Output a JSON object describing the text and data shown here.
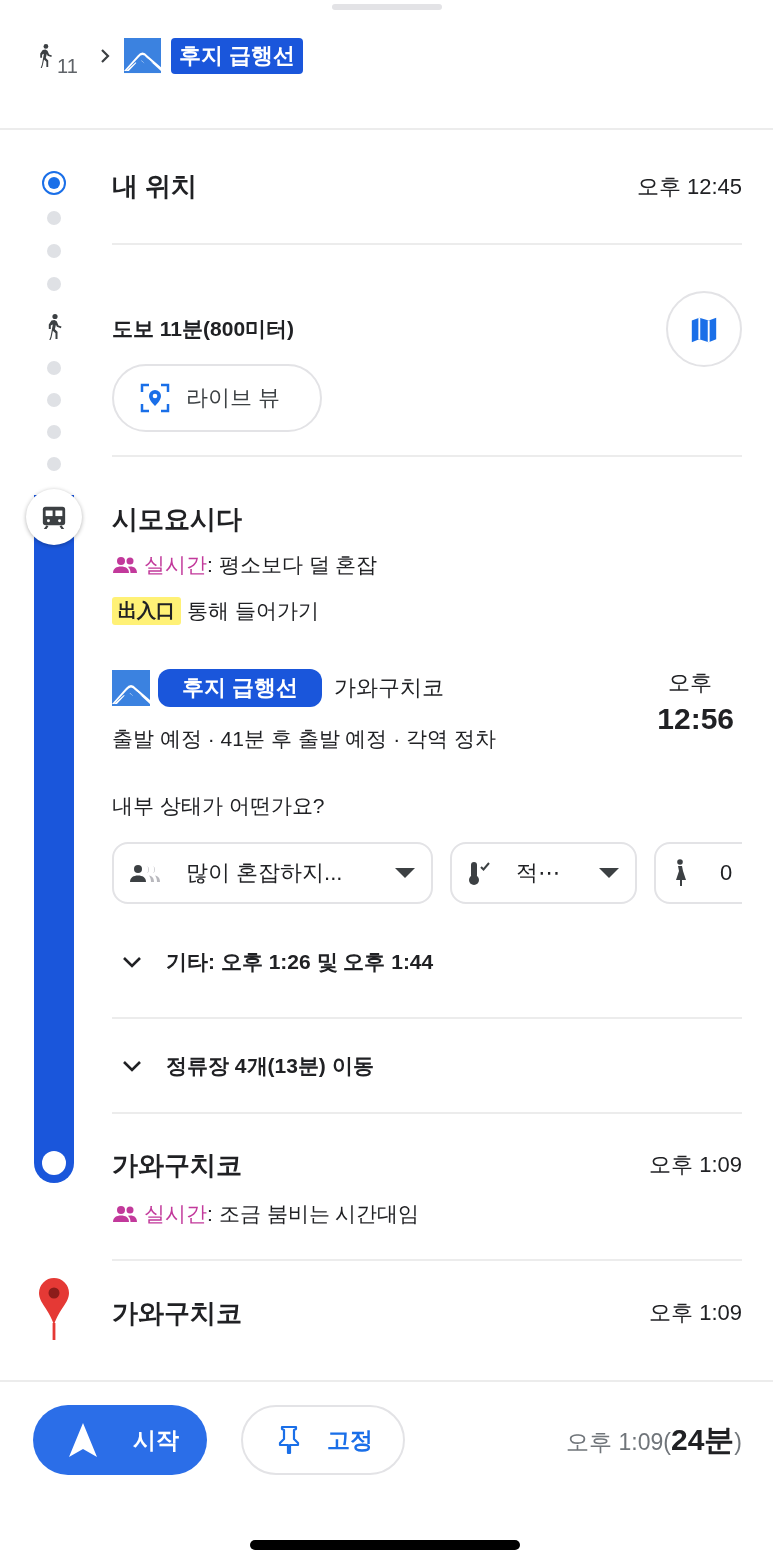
{
  "header": {
    "walk_minutes": "11",
    "line_badge": "후지 급행선"
  },
  "steps": [
    {
      "kind": "origin",
      "name": "내 위치",
      "time": "오후 12:45"
    },
    {
      "kind": "walk",
      "text": "도보 11분(800미터)",
      "live_view_button": "라이브 뷰"
    },
    {
      "kind": "transit",
      "station": "시모요시다",
      "crowd": "**실시간**: 평소보다 덜 혼잡",
      "entrance_tag": "出入口",
      "entrance_text": "통해 들어가기",
      "line_badge": "후지 급행선",
      "direction": "가와구치코",
      "departure_info": "출발 예정 · 41분 후 출발 예정 · 각역 정차",
      "time_label": "오후",
      "time": "12:56",
      "question": "내부 상태가 어떤가요?",
      "feedback": [
        {
          "kind": "crowd",
          "label": "많이 혼잡하지..."
        },
        {
          "kind": "temperature",
          "label": "적⋯"
        },
        {
          "kind": "accessibility",
          "label": "0"
        }
      ],
      "other_departures": {
        "expanded": false,
        "text": "기타: 오후 1:26 및 오후 1:44"
      },
      "stops": {
        "expanded": false,
        "text": "정류장 4개(13분) 이동"
      },
      "arrival_station": "가와구치코",
      "arrival_time": "오후 1:09",
      "arrival_crowd": "**실시간**: 조금 붐비는 시간대임"
    },
    {
      "kind": "destination",
      "name": "가와구치코",
      "time": "오후 1:09"
    }
  ],
  "footer": {
    "start_button": "시작",
    "pin_button": "고정",
    "eta": "오후 1:09(**24분**)"
  }
}
